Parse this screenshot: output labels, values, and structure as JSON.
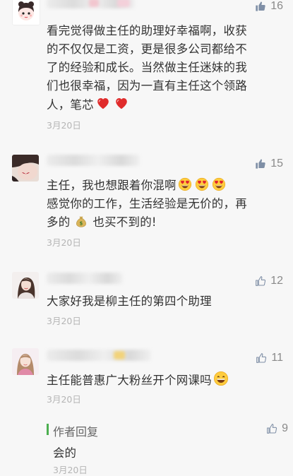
{
  "comments": [
    {
      "likes": "16",
      "text_lines": [
        "看完觉得做主任的助理好幸福啊，收获",
        "的不仅仅是工资，更是很多公司都给不",
        "了的经验和成长。当然做主任迷妹的我",
        "们也很幸福，因为一直有主任这个领路"
      ],
      "last_line": "人，笔芯",
      "date": "3月20日"
    },
    {
      "likes": "15",
      "line1": "主任，我也想跟着你混啊",
      "line2": "感觉你的工作，生活经验是无价的，再",
      "line3_pre": "多的",
      "line3_post": "也买不到的!",
      "date": "3月20日"
    },
    {
      "likes": "12",
      "text": "大家好我是柳主任的第四个助理",
      "date": "3月20日"
    },
    {
      "likes": "11",
      "text": "主任能普惠广大粉丝开个网课吗",
      "date": "3月20日"
    }
  ],
  "reply": {
    "title": "作者回复",
    "likes": "9",
    "text": "会的",
    "date": "3月20日"
  },
  "icons": {
    "like": "thumbs-up-icon",
    "heart": "red-heart-emoji",
    "heart_eyes": "heart-eyes-emoji",
    "money_bag": "money-bag-emoji",
    "grin": "grinning-emoji"
  },
  "colors": {
    "like_gray": "#8a8a8a",
    "date_gray": "#b5b5b5",
    "reply_bar": "#4caf50",
    "heart": "#e02c2c"
  }
}
